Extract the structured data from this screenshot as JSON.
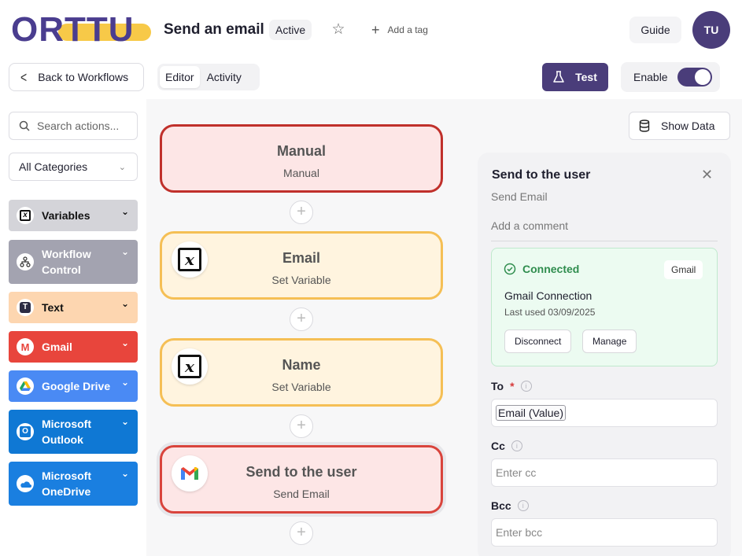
{
  "header": {
    "logo_text": "ORTTU",
    "title": "Send an email",
    "status": "Active",
    "add_tag": "Add a tag",
    "guide": "Guide",
    "avatar": "TU"
  },
  "toolbar": {
    "back": "Back to Workflows",
    "tabs": [
      "Editor",
      "Activity"
    ],
    "active_tab": "Editor",
    "test": "Test",
    "enable": "Enable",
    "enabled": true,
    "show_data": "Show Data"
  },
  "sidebar": {
    "search_placeholder": "Search actions...",
    "category_select": "All Categories",
    "categories": [
      {
        "label": "Variables",
        "bg": "#d4d4d9",
        "fg": "#111111"
      },
      {
        "label": "Workflow Control",
        "bg": "#a3a3b0",
        "fg": "#ffffff"
      },
      {
        "label": "Text",
        "bg": "#fdd6b0",
        "fg": "#111111"
      },
      {
        "label": "Gmail",
        "bg": "#e8453c",
        "fg": "#ffffff"
      },
      {
        "label": "Google Drive",
        "bg": "#4a8af4",
        "fg": "#ffffff"
      },
      {
        "label": "Microsoft Outlook",
        "bg": "#0f78d4",
        "fg": "#ffffff"
      },
      {
        "label": "Microsoft OneDrive",
        "bg": "#1a7fe0",
        "fg": "#ffffff"
      }
    ]
  },
  "workflow": {
    "nodes": [
      {
        "title": "Manual",
        "subtitle": "Manual",
        "border": "#c0302b",
        "bg": "#fde6e6",
        "icon": ""
      },
      {
        "title": "Email",
        "subtitle": "Set Variable",
        "border": "#f5bf55",
        "bg": "#fff4df",
        "icon": "variable-icon"
      },
      {
        "title": "Name",
        "subtitle": "Set Variable",
        "border": "#f5bf55",
        "bg": "#fff4df",
        "icon": "variable-icon"
      },
      {
        "title": "Send to the user",
        "subtitle": "Send Email",
        "border": "#d9443c",
        "bg": "#fde6e6",
        "icon": "gmail-icon"
      }
    ]
  },
  "panel": {
    "title": "Send to the user",
    "subtitle": "Send Email",
    "comment_placeholder": "Add a comment",
    "connection": {
      "status": "Connected",
      "service": "Gmail",
      "name": "Gmail Connection",
      "last_used": "Last used 03/09/2025",
      "disconnect": "Disconnect",
      "manage": "Manage"
    },
    "fields": {
      "to_label": "To",
      "to_required": "*",
      "to_value": "Email (Value)",
      "cc_label": "Cc",
      "cc_placeholder": "Enter cc",
      "bcc_label": "Bcc",
      "bcc_placeholder": "Enter bcc"
    }
  },
  "colors": {
    "brand": "#4a3d7a",
    "logo_accent": "#f7c948",
    "connected": "#2f8d4e"
  }
}
